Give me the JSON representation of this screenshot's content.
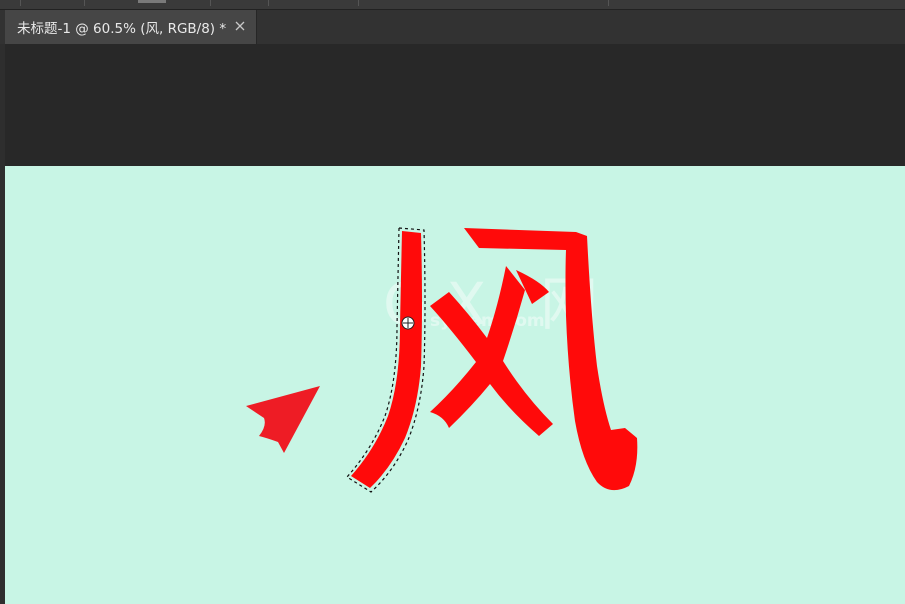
{
  "document_tab": {
    "title": "未标题-1 @ 60.5% (风, RGB/8) *",
    "close_icon": "close-icon"
  },
  "canvas": {
    "background_color": "#c8f5e5",
    "glyph": "风",
    "glyph_color": "#ff0a0a",
    "arrow_color": "#ee1c25",
    "watermark_text": "G X I 网",
    "watermark_sub": "system.com"
  },
  "cursor": {
    "icon": "move-crosshair-icon"
  }
}
